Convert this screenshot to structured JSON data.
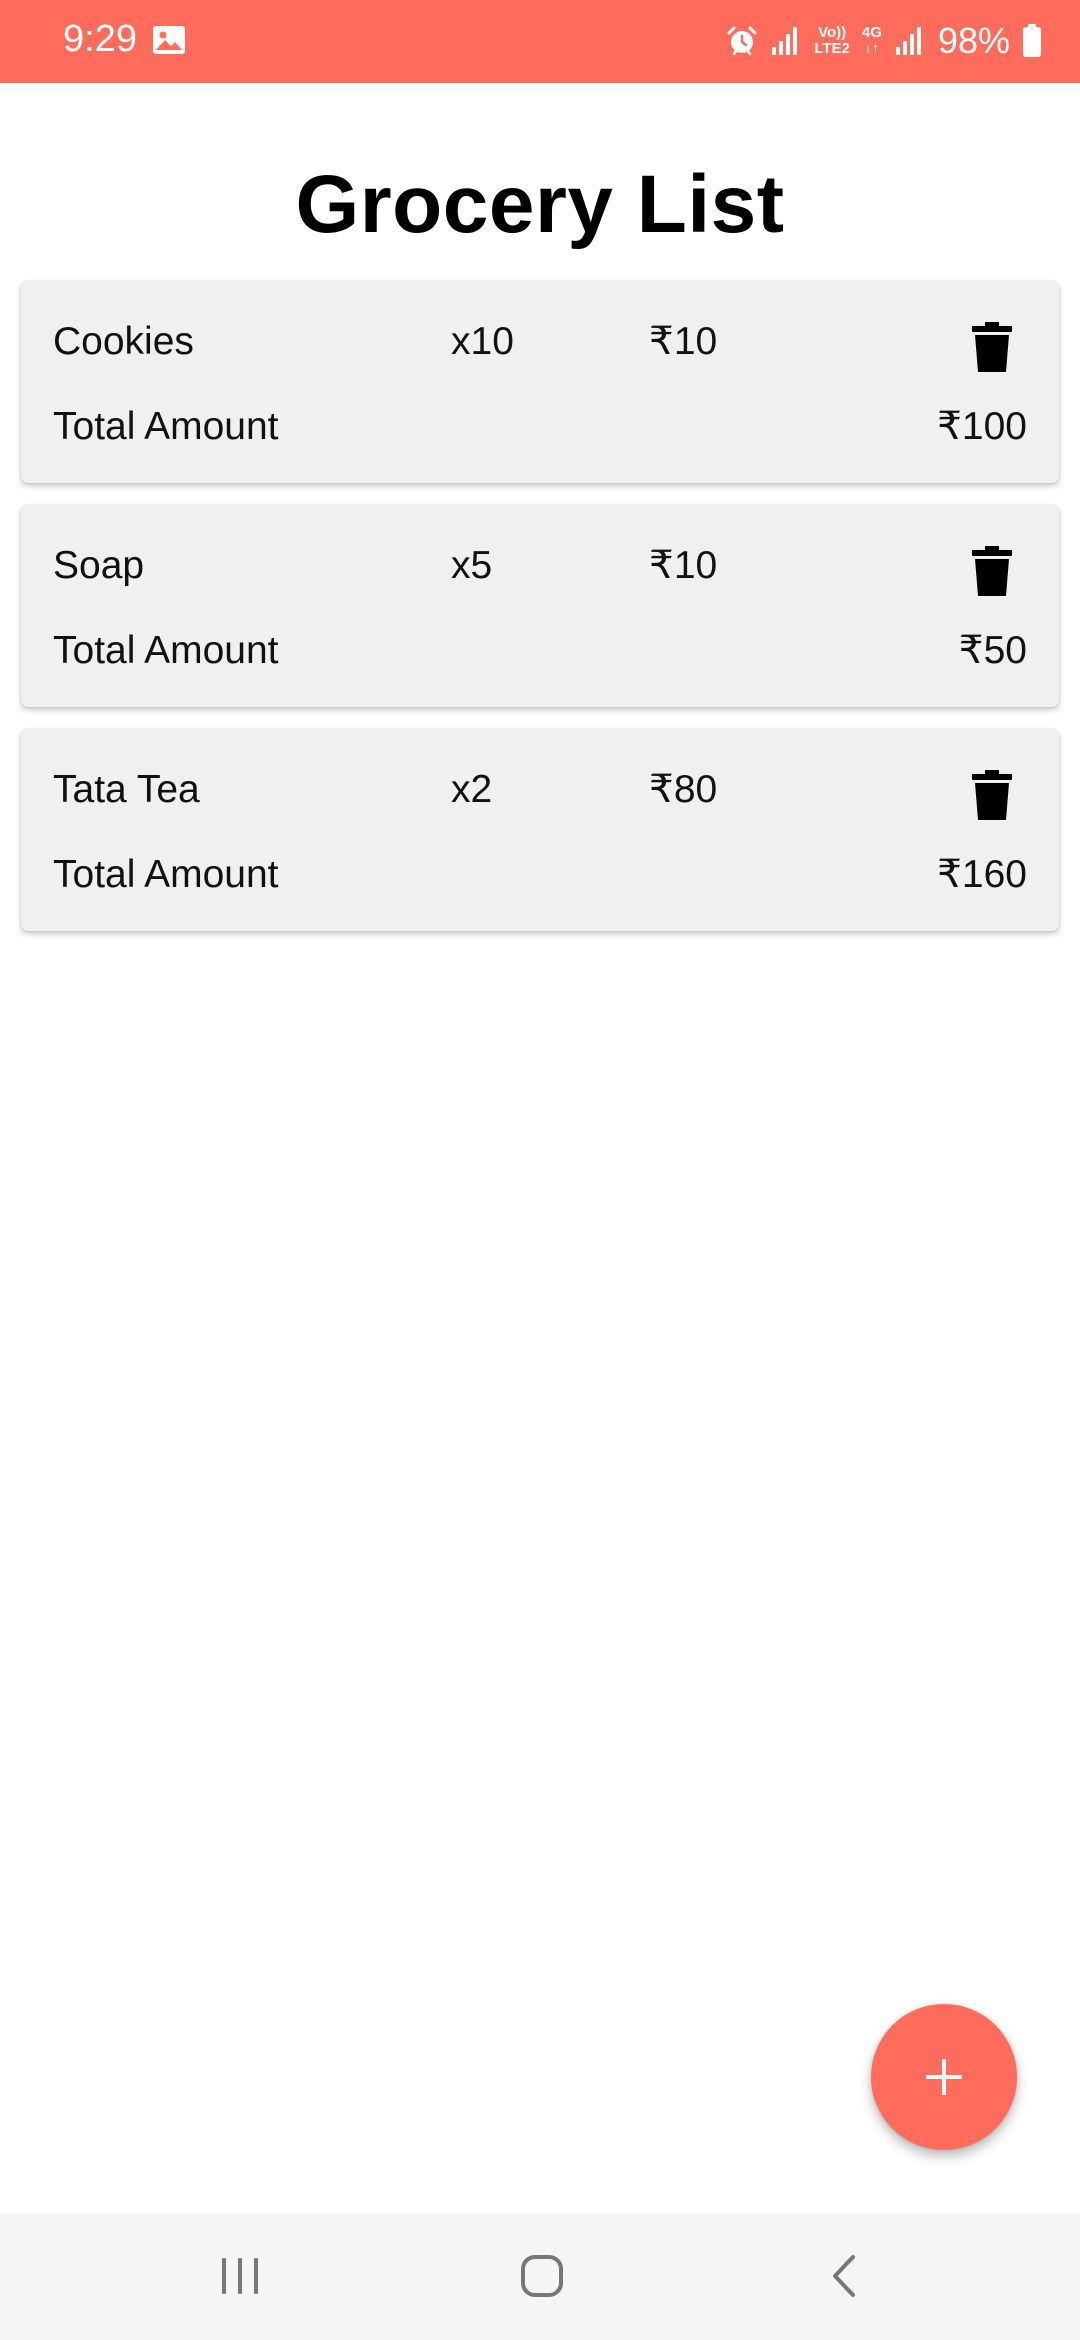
{
  "status_bar": {
    "time": "9:29",
    "battery": "98%",
    "network_label_top": "Vo))",
    "network_label_bottom": "LTE2",
    "data_type": "4G",
    "background_color": "#ff6c5c",
    "icons": [
      "gallery-icon",
      "alarm-icon",
      "signal-icon",
      "volte-icon",
      "data-4g-icon",
      "signal-icon",
      "battery-icon"
    ]
  },
  "title": "Grocery List",
  "items": [
    {
      "name": "Cookies",
      "quantity": "x10",
      "price": "₹10",
      "total_label": "Total Amount",
      "total": "₹100"
    },
    {
      "name": "Soap",
      "quantity": "x5",
      "price": "₹10",
      "total_label": "Total Amount",
      "total": "₹50"
    },
    {
      "name": "Tata Tea",
      "quantity": "x2",
      "price": "₹80",
      "total_label": "Total Amount",
      "total": "₹160"
    }
  ],
  "fab": {
    "icon": "plus-icon",
    "color": "#ff6c5c"
  },
  "nav_bar": {
    "icons": [
      "recents-icon",
      "home-icon",
      "back-icon"
    ]
  }
}
